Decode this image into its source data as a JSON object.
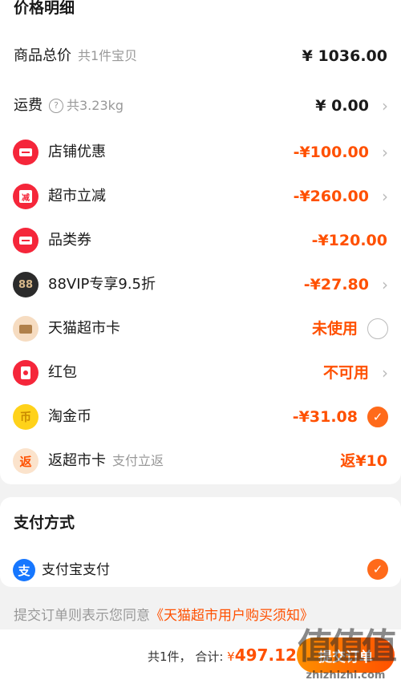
{
  "price_detail": {
    "title": "价格明细",
    "goods_total": {
      "label": "商品总价",
      "sub": "共1件宝贝",
      "value": "¥ 1036.00"
    },
    "shipping": {
      "label": "运费",
      "sub": "共3.23kg",
      "value": "¥ 0.00"
    },
    "discounts": [
      {
        "icon": "ticket-icon",
        "label": "店铺优惠",
        "value": "-¥100.00"
      },
      {
        "icon": "supermarket-reduce-icon",
        "label": "超市立减",
        "value": "-¥260.00"
      },
      {
        "icon": "ticket-icon",
        "label": "品类券",
        "value": "-¥120.00"
      },
      {
        "icon": "88vip-icon",
        "label": "88VIP专享9.5折",
        "value": "-¥27.80"
      },
      {
        "icon": "tmall-card-icon",
        "label": "天猫超市卡",
        "value": "未使用"
      },
      {
        "icon": "red-packet-icon",
        "label": "红包",
        "value": "不可用"
      },
      {
        "icon": "taojin-coin-icon",
        "label": "淘金币",
        "value": "-¥31.08"
      },
      {
        "icon": "cashback-icon",
        "label": "返超市卡",
        "sub": "支付立返",
        "value": "返¥10"
      }
    ],
    "icon_text": {
      "reduce": "减",
      "vip": "88",
      "coin": "币",
      "cashback": "返"
    }
  },
  "payment": {
    "title": "支付方式",
    "method": {
      "icon": "alipay-icon",
      "icon_text": "支",
      "label": "支付宝支付"
    }
  },
  "agreement": {
    "prefix": "提交订单则表示您同意",
    "link": "《天猫超市用户购买须知》"
  },
  "footer": {
    "count": "共1件，",
    "total_label": "合计:",
    "currency": "¥",
    "total": "497.12",
    "submit_label": "提交订单"
  },
  "watermark": {
    "text": "值值值",
    "url": "zhizhizhi.com"
  },
  "colors": {
    "accent": "#ff5000",
    "alipay": "#1677ff",
    "background": "#f2f2f2"
  }
}
